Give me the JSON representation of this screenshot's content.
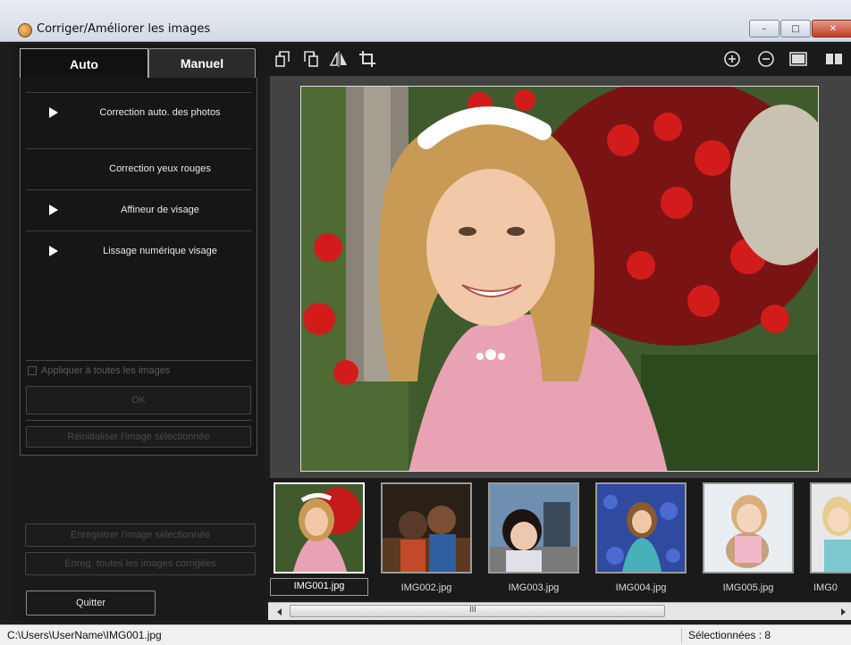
{
  "window": {
    "title": "Corriger/Améliorer les images",
    "controls": {
      "minimize": "–",
      "maximize": "□",
      "close": "✕"
    }
  },
  "tabs": [
    {
      "label": "Auto",
      "active": true
    },
    {
      "label": "Manuel",
      "active": false
    }
  ],
  "auto_panel": {
    "items": [
      {
        "label": "Correction auto. des photos",
        "has_arrow": true
      },
      {
        "label": "Correction yeux rouges",
        "has_arrow": false
      },
      {
        "label": "Affineur de visage",
        "has_arrow": true
      },
      {
        "label": "Lissage numérique visage",
        "has_arrow": true
      }
    ],
    "apply_all_label": "Appliquer à toutes les images",
    "ok_label": "OK",
    "reset_label": "Réinitialiser l'image sélectionnée"
  },
  "save_buttons": {
    "save_selected": "Enregistrer l'image sélectionnée",
    "save_all": "Enreg. toutes les images corrigées"
  },
  "quit_label": "Quitter",
  "toolbar": {
    "left_icons": [
      "rotate-left-icon",
      "rotate-right-icon",
      "flip-horizontal-icon",
      "crop-icon"
    ],
    "right_icons": [
      "zoom-in-icon",
      "zoom-out-icon",
      "full-screen-icon",
      "compare-icon"
    ]
  },
  "thumbnails": [
    {
      "filename": "IMG001.jpg",
      "selected": true
    },
    {
      "filename": "IMG002.jpg",
      "selected": false
    },
    {
      "filename": "IMG003.jpg",
      "selected": false
    },
    {
      "filename": "IMG004.jpg",
      "selected": false
    },
    {
      "filename": "IMG005.jpg",
      "selected": false
    },
    {
      "filename": "IMG0",
      "selected": false
    }
  ],
  "scrollbar": {
    "grip": "III"
  },
  "status": {
    "path": "C:\\Users\\UserName\\IMG001.jpg",
    "selected_count": "Sélectionnées : 8"
  },
  "colors": {
    "panel_bg": "#1a1a1a",
    "view_bg": "#434343",
    "text_light": "#e8e8e8",
    "disabled_text": "#4a4a4a"
  }
}
